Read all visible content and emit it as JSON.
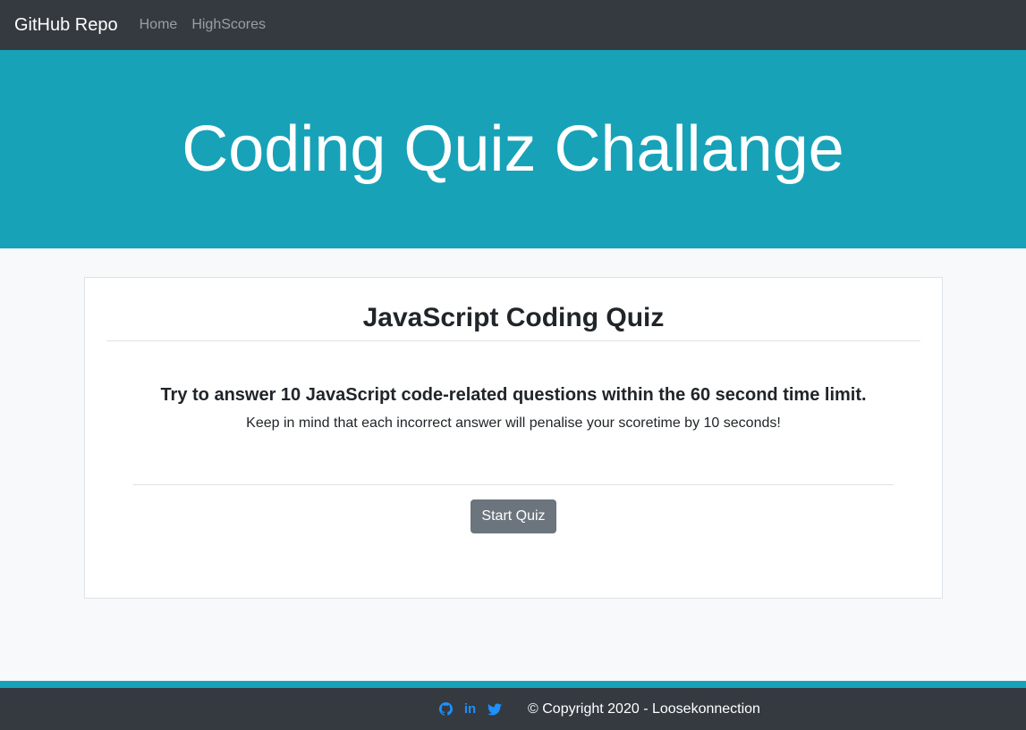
{
  "navbar": {
    "brand": "GitHub Repo",
    "links": [
      "Home",
      "HighScores"
    ]
  },
  "hero": {
    "title": "Coding Quiz Challange"
  },
  "card": {
    "title": "JavaScript Coding Quiz",
    "lead": "Try to answer 10 JavaScript code-related questions within the 60 second time limit.",
    "subtext": "Keep in mind that each incorrect answer will penalise your scoretime by 10 seconds!",
    "button_label": "Start Quiz"
  },
  "footer": {
    "social_icons": [
      "github-icon",
      "linkedin-icon",
      "twitter-icon"
    ],
    "linkedin_glyph": "in",
    "copyright": "© Copyright 2020 - Loosekonnection"
  },
  "colors": {
    "navbar_bg": "#343a40",
    "hero_bg": "#17a2b8",
    "button_bg": "#6c757d",
    "social_icon": "#1e90ff"
  }
}
